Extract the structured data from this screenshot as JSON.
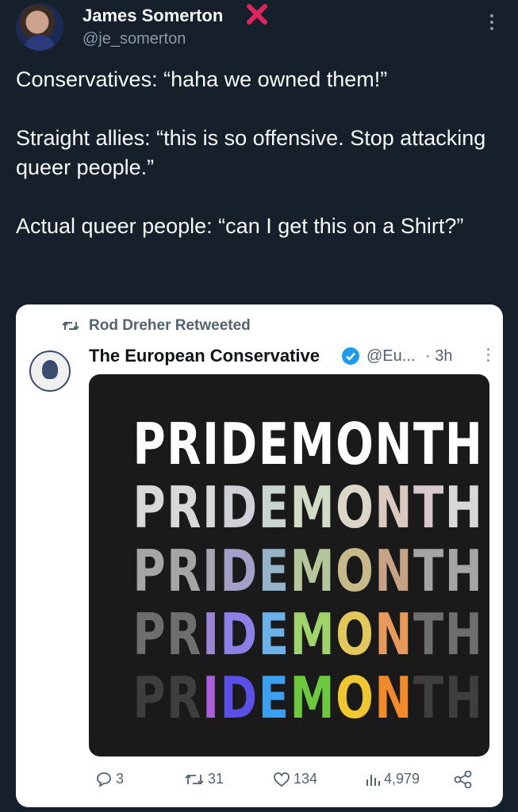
{
  "tweet": {
    "author_name": "James Somerton",
    "author_handle": "@je_somerton",
    "lines": [
      "Conservatives: “haha we owned them!”",
      "Straight allies: “this is so offensive. Stop attacking queer people.”",
      "Actual queer people: “can I get this on a Shirt?”"
    ]
  },
  "quote": {
    "retweet_label": "Rod Dreher Retweeted",
    "name": "The European Conservative",
    "handle": "@Eu...",
    "time": "· 3h",
    "image_word": "PRIDEMONTH",
    "image_word_letters": [
      "P",
      "R",
      "I",
      "D",
      "E",
      "M",
      "O",
      "N",
      "T",
      "H"
    ],
    "rows": [
      {
        "colors": [
          "#ffffff",
          "#ffffff",
          "#ffffff",
          "#ffffff",
          "#ffffff",
          "#ffffff",
          "#ffffff",
          "#ffffff",
          "#ffffff",
          "#ffffff"
        ]
      },
      {
        "colors": [
          "#d8d8d8",
          "#d8d8d8",
          "#d8d8d8",
          "#cfcfd8",
          "#c9d4cf",
          "#d1dcc7",
          "#dbd6c7",
          "#d9c9be",
          "#d8c8cc",
          "#d8d8d8"
        ]
      },
      {
        "colors": [
          "#a5a5a5",
          "#a5a5a5",
          "#a7a5b2",
          "#a3a0c8",
          "#94b3c8",
          "#b4c79a",
          "#c7b98a",
          "#c7a385",
          "#a5a5a5",
          "#a5a5a5"
        ]
      },
      {
        "colors": [
          "#6e6e6e",
          "#6e6e6e",
          "#9b86d6",
          "#8c80e8",
          "#6cb2ea",
          "#9fd46a",
          "#e2c85a",
          "#e89a5a",
          "#6e6e6e",
          "#6e6e6e"
        ]
      },
      {
        "colors": [
          "#3e3e3e",
          "#3e3e3e",
          "#a95fd9",
          "#5a4fe6",
          "#3d9ff0",
          "#6cc93e",
          "#f0c72e",
          "#f08a2a",
          "#3e3e3e",
          "#3e3e3e"
        ]
      }
    ],
    "stats": {
      "replies": "3",
      "retweets": "31",
      "likes": "134",
      "views": "4,979"
    }
  },
  "colors": {
    "background": "#15202b",
    "card": "#ffffff",
    "secondary_text": "#8b98a5",
    "verified": "#1d9bf0",
    "x_mark": "#e0245e"
  }
}
